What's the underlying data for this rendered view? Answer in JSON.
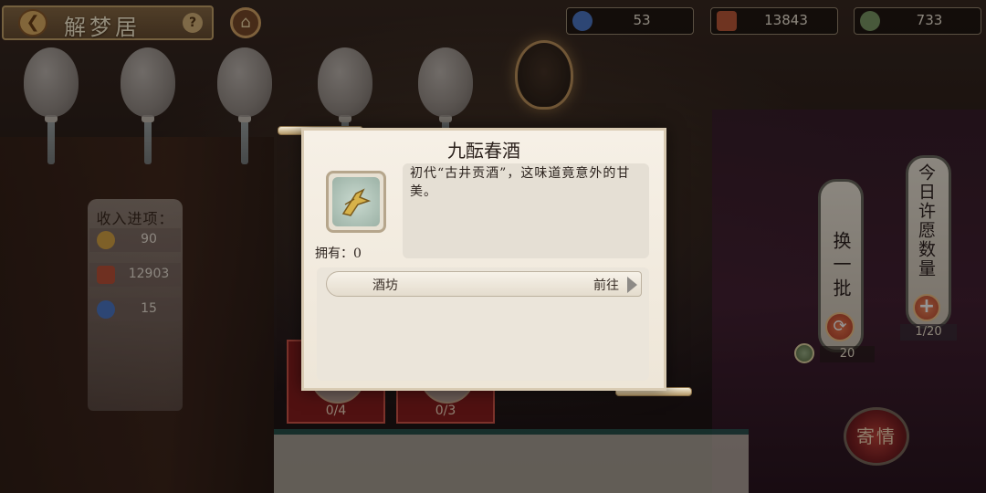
{
  "header": {
    "title": "解梦居",
    "back_icon": "❮",
    "help_icon": "?",
    "home_icon": "⌂"
  },
  "resources": [
    {
      "name": "spirit",
      "value": "53",
      "color": "#4f79c9"
    },
    {
      "name": "chest",
      "value": "13843",
      "color": "#c05a3a"
    },
    {
      "name": "coin",
      "value": "733",
      "color": "#7c9a66"
    }
  ],
  "income": {
    "title": "收入进项：",
    "rows": [
      {
        "icon": "star-icon",
        "value": "90",
        "color": "#d9a545"
      },
      {
        "icon": "chest-icon",
        "value": "12903",
        "color": "#c0533a"
      },
      {
        "icon": "spirit-icon",
        "value": "15",
        "color": "#4f79c9"
      }
    ]
  },
  "cards": [
    {
      "count": "0/4"
    },
    {
      "count": "0/3"
    }
  ],
  "right": {
    "swap_label": "换一批",
    "swap_icon": "⟳",
    "swap_cost": "20",
    "wish_label": "今日许愿数量",
    "wish_plus": "+",
    "wish_count": "1/20",
    "send_label": "寄情"
  },
  "dialog": {
    "title": "九酝春酒",
    "description": "初代“古井贡酒”，这味道竟意外的甘美。",
    "owned": "拥有：0",
    "source": {
      "name": "酒坊",
      "action": "前往"
    }
  }
}
